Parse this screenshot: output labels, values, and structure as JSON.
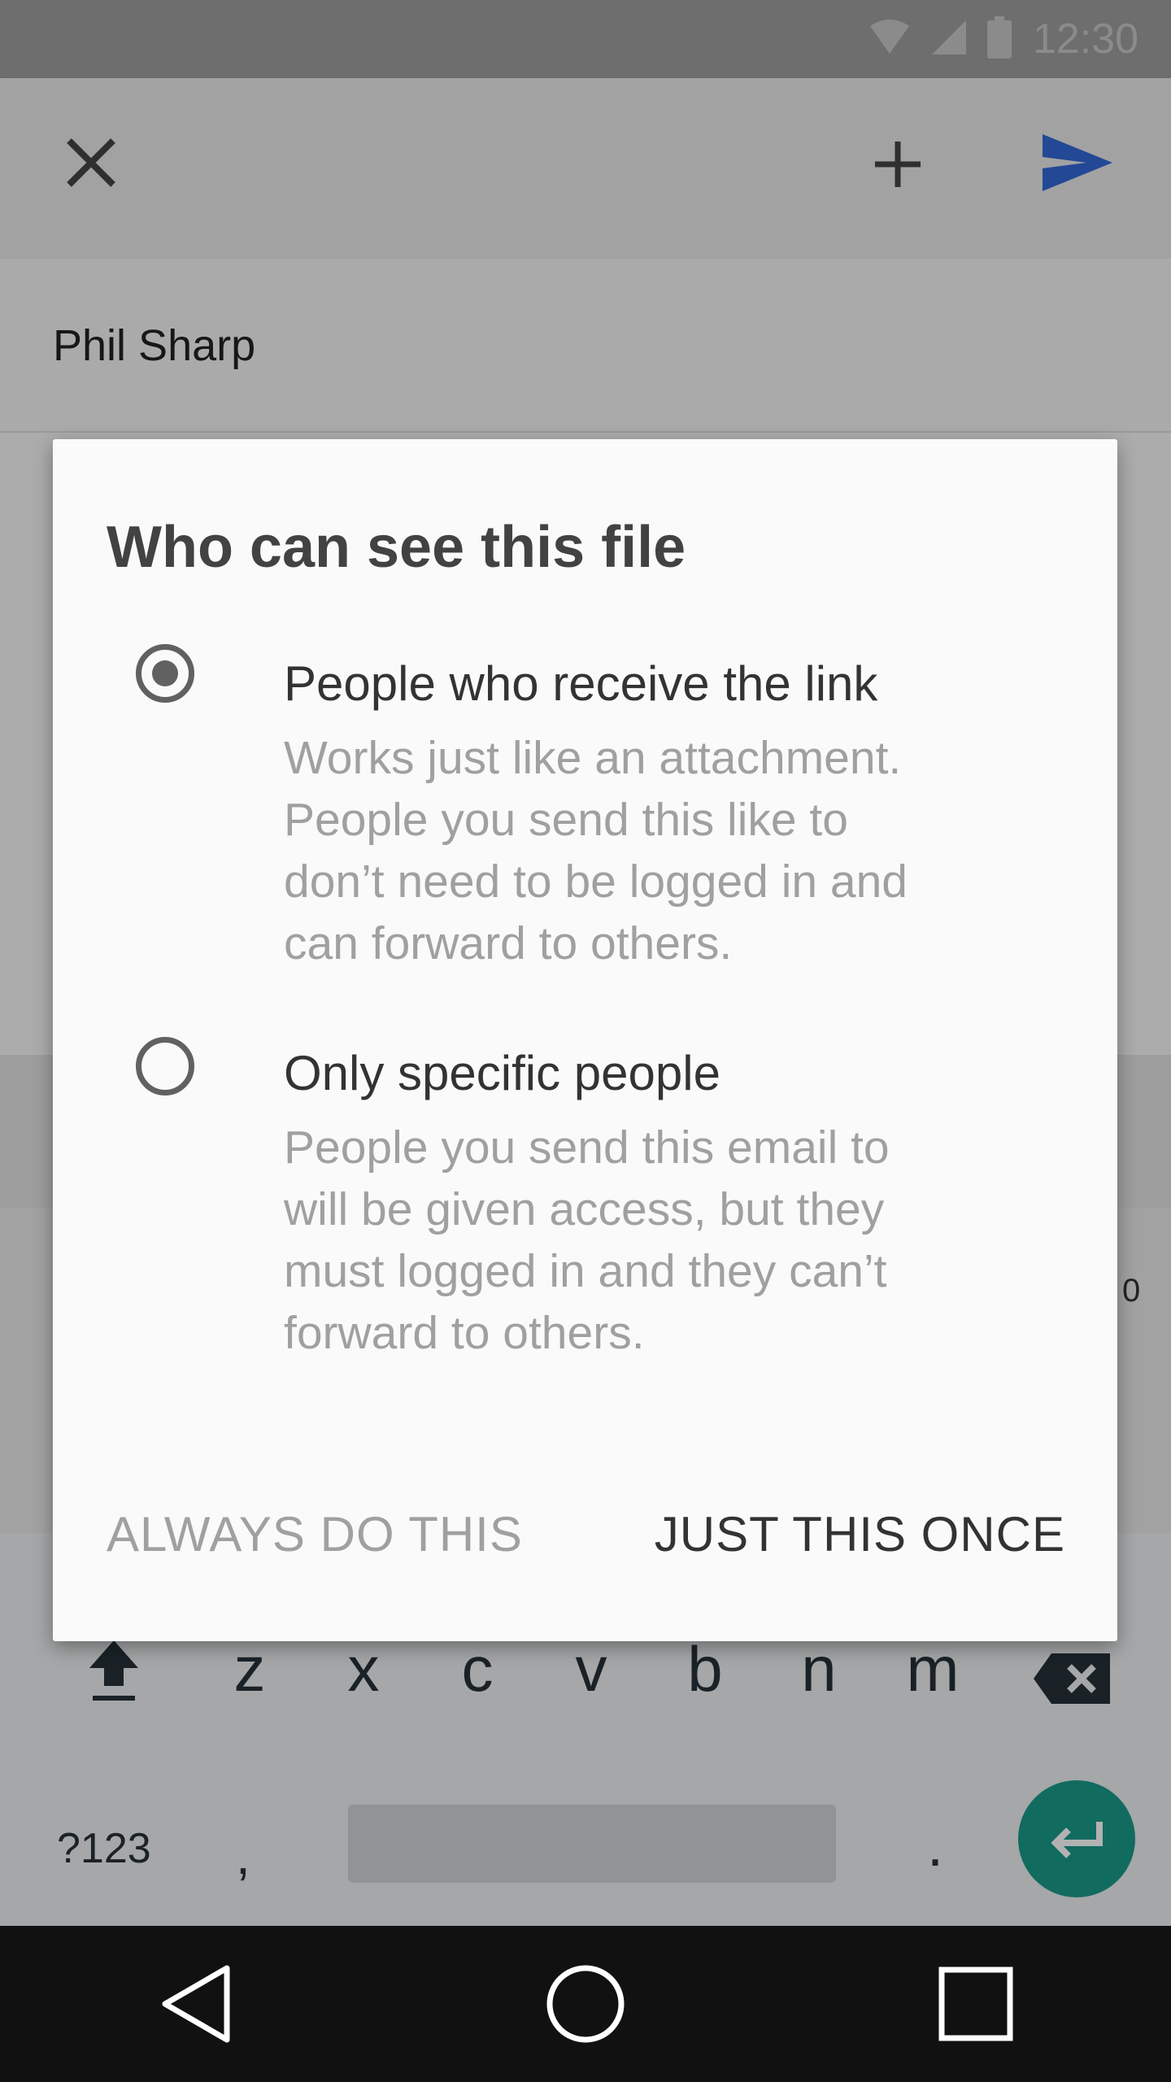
{
  "status_bar": {
    "time": "12:30",
    "icons": [
      "wifi-icon",
      "cellular-signal-icon",
      "battery-icon"
    ]
  },
  "toolbar": {
    "icons": [
      "close-icon",
      "add-icon",
      "send-icon"
    ],
    "send_color": "#3367d6"
  },
  "recipient": {
    "name": "Phil Sharp"
  },
  "background_peek": {
    "fragment_1": "0"
  },
  "dialog": {
    "title": "Who can see this file",
    "options": [
      {
        "title": "People who receive the link",
        "selected": true,
        "description": [
          "Works just like an attachment.",
          "People you send this like to",
          "don’t need to be logged in and",
          "can forward to others."
        ]
      },
      {
        "title": "Only specific people",
        "selected": false,
        "description": [
          "People you send this email to",
          "will be given access, but they",
          "must logged in and they can’t",
          "forward to others."
        ]
      }
    ],
    "buttons": {
      "always": "ALWAYS DO THIS",
      "once": "JUST THIS ONCE"
    }
  },
  "keyboard": {
    "row_bottom_letters": [
      "z",
      "x",
      "c",
      "v",
      "b",
      "n",
      "m"
    ],
    "symbols_key": "?123",
    "comma_key": ",",
    "period_key": ".",
    "accent_color": "#1a9a88"
  },
  "navigation_bar": {
    "icons": [
      "back-icon",
      "home-icon",
      "recents-icon"
    ]
  }
}
